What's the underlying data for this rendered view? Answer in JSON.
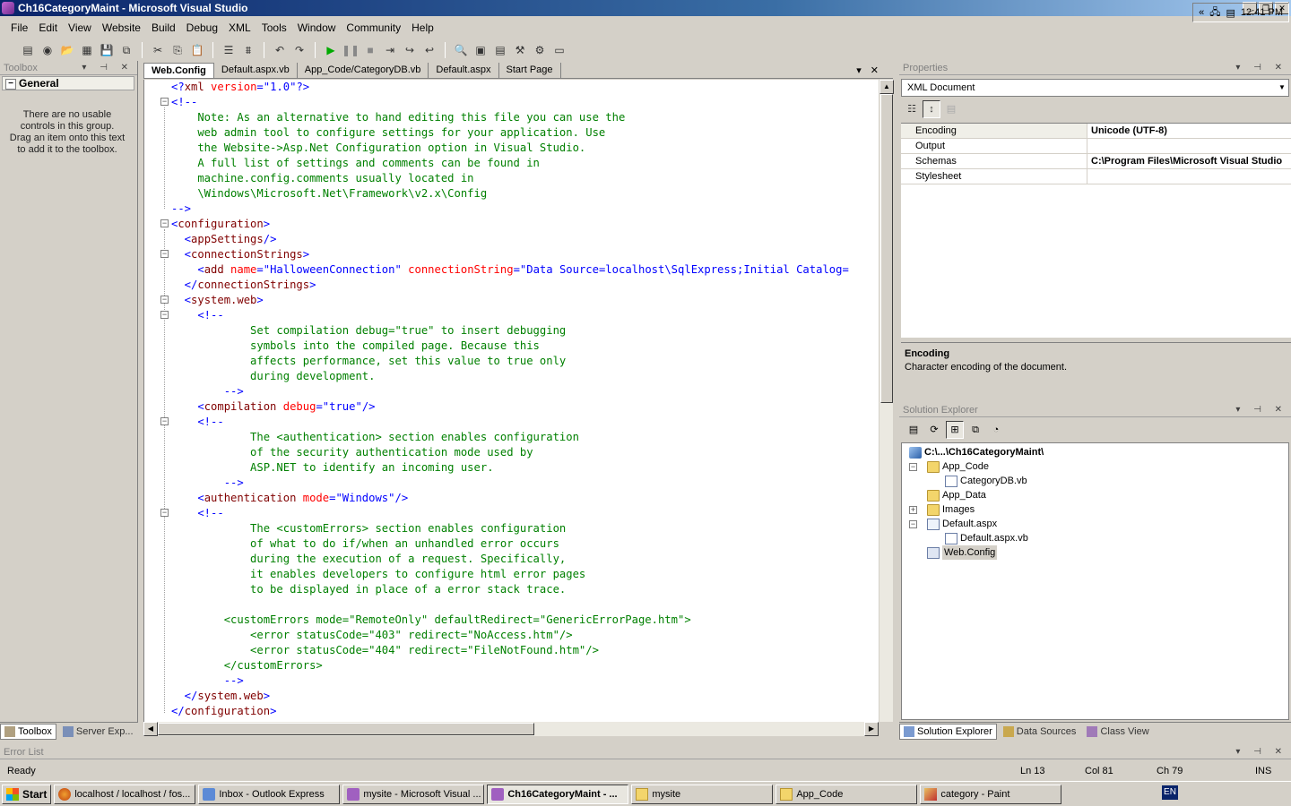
{
  "window": {
    "title": "Ch16CategoryMaint - Microsoft Visual Studio"
  },
  "menu": [
    "File",
    "Edit",
    "View",
    "Website",
    "Build",
    "Debug",
    "XML",
    "Tools",
    "Window",
    "Community",
    "Help"
  ],
  "toolbox": {
    "title": "Toolbox",
    "group": "General",
    "empty_text": "There are no usable controls in this group. Drag an item onto this text to add it to the toolbox.",
    "tabs": [
      "Toolbox",
      "Server Exp..."
    ]
  },
  "editor": {
    "tabs": [
      "Web.Config",
      "Default.aspx.vb",
      "App_Code/CategoryDB.vb",
      "Default.aspx",
      "Start Page"
    ],
    "active_tab": "Web.Config"
  },
  "properties": {
    "title": "Properties",
    "object": "XML Document",
    "rows": [
      {
        "name": "Encoding",
        "value": "Unicode (UTF-8)"
      },
      {
        "name": "Output",
        "value": ""
      },
      {
        "name": "Schemas",
        "value": "C:\\Program Files\\Microsoft Visual Studio"
      },
      {
        "name": "Stylesheet",
        "value": ""
      }
    ],
    "description_title": "Encoding",
    "description_text": "Character encoding of the document."
  },
  "solution": {
    "title": "Solution Explorer",
    "root": "C:\\...\\Ch16CategoryMaint\\",
    "items": [
      "App_Code",
      "CategoryDB.vb",
      "App_Data",
      "Images",
      "Default.aspx",
      "Default.aspx.vb",
      "Web.Config"
    ],
    "tabs": [
      "Solution Explorer",
      "Data Sources",
      "Class View"
    ]
  },
  "errorlist": {
    "title": "Error List"
  },
  "status": {
    "ready": "Ready",
    "line": "Ln 13",
    "col": "Col 81",
    "ch": "Ch 79",
    "mode": "INS"
  },
  "taskbar": {
    "start": "Start",
    "tasks": [
      "localhost / localhost / fos...",
      "Inbox - Outlook Express",
      "mysite - Microsoft Visual ...",
      "Ch16CategoryMaint - ...",
      "mysite",
      "App_Code",
      "category - Paint"
    ],
    "active_task": "Ch16CategoryMaint - ...",
    "lang": "EN",
    "clock": "12:41 PM"
  },
  "code_lines": [
    [
      {
        "t": "<?",
        "c": "dl"
      },
      {
        "t": "xml",
        "c": "tg"
      },
      {
        "t": " version",
        "c": "at"
      },
      {
        "t": "=\"1.0\"",
        "c": "vl"
      },
      {
        "t": "?>",
        "c": "dl"
      }
    ],
    [
      {
        "t": "<!--",
        "c": "dl"
      }
    ],
    [
      {
        "t": "    Note: As an alternative to hand editing this file you can use the",
        "c": "cm"
      }
    ],
    [
      {
        "t": "    web admin tool to configure settings for your application. Use",
        "c": "cm"
      }
    ],
    [
      {
        "t": "    the Website->Asp.Net Configuration option in Visual Studio.",
        "c": "cm"
      }
    ],
    [
      {
        "t": "    A full list of settings and comments can be found in",
        "c": "cm"
      }
    ],
    [
      {
        "t": "    machine.config.comments usually located in",
        "c": "cm"
      }
    ],
    [
      {
        "t": "    \\Windows\\Microsoft.Net\\Framework\\v2.x\\Config",
        "c": "cm"
      }
    ],
    [
      {
        "t": "-->",
        "c": "dl"
      }
    ],
    [
      {
        "t": "<",
        "c": "dl"
      },
      {
        "t": "configuration",
        "c": "tg"
      },
      {
        "t": ">",
        "c": "dl"
      }
    ],
    [
      {
        "t": "  <",
        "c": "dl"
      },
      {
        "t": "appSettings",
        "c": "tg"
      },
      {
        "t": "/>",
        "c": "dl"
      }
    ],
    [
      {
        "t": "  <",
        "c": "dl"
      },
      {
        "t": "connectionStrings",
        "c": "tg"
      },
      {
        "t": ">",
        "c": "dl"
      }
    ],
    [
      {
        "t": "    <",
        "c": "dl"
      },
      {
        "t": "add",
        "c": "tg"
      },
      {
        "t": " name",
        "c": "at"
      },
      {
        "t": "=\"HalloweenConnection\"",
        "c": "vl"
      },
      {
        "t": " connectionString",
        "c": "at"
      },
      {
        "t": "=\"Data Source=localhost\\SqlExpress;Initial Catalog=",
        "c": "vl"
      }
    ],
    [
      {
        "t": "  </",
        "c": "dl"
      },
      {
        "t": "connectionStrings",
        "c": "tg"
      },
      {
        "t": ">",
        "c": "dl"
      }
    ],
    [
      {
        "t": "  <",
        "c": "dl"
      },
      {
        "t": "system.web",
        "c": "tg"
      },
      {
        "t": ">",
        "c": "dl"
      }
    ],
    [
      {
        "t": "    <!--",
        "c": "dl"
      }
    ],
    [
      {
        "t": "            Set compilation debug=\"true\" to insert debugging",
        "c": "cm"
      }
    ],
    [
      {
        "t": "            symbols into the compiled page. Because this",
        "c": "cm"
      }
    ],
    [
      {
        "t": "            affects performance, set this value to true only",
        "c": "cm"
      }
    ],
    [
      {
        "t": "            during development.",
        "c": "cm"
      }
    ],
    [
      {
        "t": "        -->",
        "c": "dl"
      }
    ],
    [
      {
        "t": "    <",
        "c": "dl"
      },
      {
        "t": "compilation",
        "c": "tg"
      },
      {
        "t": " debug",
        "c": "at"
      },
      {
        "t": "=\"true\"",
        "c": "vl"
      },
      {
        "t": "/>",
        "c": "dl"
      }
    ],
    [
      {
        "t": "    <!--",
        "c": "dl"
      }
    ],
    [
      {
        "t": "            The <authentication> section enables configuration",
        "c": "cm"
      }
    ],
    [
      {
        "t": "            of the security authentication mode used by",
        "c": "cm"
      }
    ],
    [
      {
        "t": "            ASP.NET to identify an incoming user.",
        "c": "cm"
      }
    ],
    [
      {
        "t": "        -->",
        "c": "dl"
      }
    ],
    [
      {
        "t": "    <",
        "c": "dl"
      },
      {
        "t": "authentication",
        "c": "tg"
      },
      {
        "t": " mode",
        "c": "at"
      },
      {
        "t": "=\"Windows\"",
        "c": "vl"
      },
      {
        "t": "/>",
        "c": "dl"
      }
    ],
    [
      {
        "t": "    <!--",
        "c": "dl"
      }
    ],
    [
      {
        "t": "            The <customErrors> section enables configuration",
        "c": "cm"
      }
    ],
    [
      {
        "t": "            of what to do if/when an unhandled error occurs",
        "c": "cm"
      }
    ],
    [
      {
        "t": "            during the execution of a request. Specifically,",
        "c": "cm"
      }
    ],
    [
      {
        "t": "            it enables developers to configure html error pages",
        "c": "cm"
      }
    ],
    [
      {
        "t": "            to be displayed in place of a error stack trace.",
        "c": "cm"
      }
    ],
    [
      {
        "t": "",
        "c": "cm"
      }
    ],
    [
      {
        "t": "        <customErrors mode=\"RemoteOnly\" defaultRedirect=\"GenericErrorPage.htm\">",
        "c": "cm"
      }
    ],
    [
      {
        "t": "            <error statusCode=\"403\" redirect=\"NoAccess.htm\"/>",
        "c": "cm"
      }
    ],
    [
      {
        "t": "            <error statusCode=\"404\" redirect=\"FileNotFound.htm\"/>",
        "c": "cm"
      }
    ],
    [
      {
        "t": "        </customErrors>",
        "c": "cm"
      }
    ],
    [
      {
        "t": "        -->",
        "c": "dl"
      }
    ],
    [
      {
        "t": "  </",
        "c": "dl"
      },
      {
        "t": "system.web",
        "c": "tg"
      },
      {
        "t": ">",
        "c": "dl"
      }
    ],
    [
      {
        "t": "</",
        "c": "dl"
      },
      {
        "t": "configuration",
        "c": "tg"
      },
      {
        "t": ">",
        "c": "dl"
      }
    ]
  ]
}
